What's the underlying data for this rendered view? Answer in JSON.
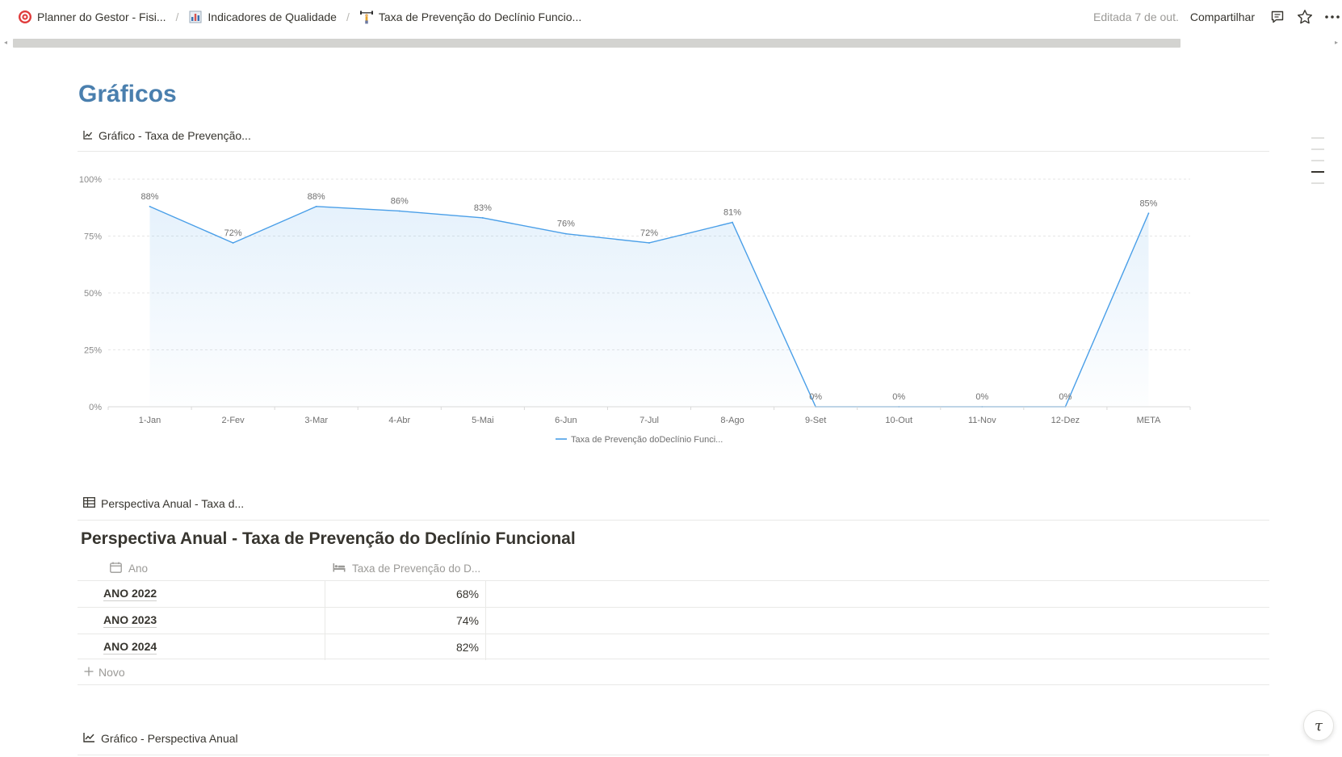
{
  "breadcrumbs": [
    {
      "label": "Planner do Gestor - Fisi...",
      "icon": "target-icon"
    },
    {
      "label": "Indicadores de Qualidade",
      "icon": "bar-chart-icon"
    },
    {
      "label": "Taxa de Prevenção do Declínio Funcio...",
      "icon": "weightlifter-icon"
    }
  ],
  "topbar": {
    "edited": "Editada 7 de out.",
    "share": "Compartilhar"
  },
  "page": {
    "heading": "Gráficos",
    "view1_label": "Gráfico - Taxa de Prevenção...",
    "view2_label": "Perspectiva Anual - Taxa d...",
    "view3_label": "Gráfico - Perspectiva Anual"
  },
  "table": {
    "title": "Perspectiva Anual - Taxa de Prevenção do Declínio Funcional",
    "col1": "Ano",
    "col2": "Taxa de Prevenção do D...",
    "rows": [
      {
        "ano": "ANO 2022",
        "taxa": "68%"
      },
      {
        "ano": "ANO 2023",
        "taxa": "74%"
      },
      {
        "ano": "ANO 2024",
        "taxa": "82%"
      }
    ],
    "new_label": "Novo"
  },
  "colors": {
    "line": "#4a9fe8",
    "heading": "#4a7fae"
  },
  "chart_data": {
    "type": "area",
    "categories": [
      "1-Jan",
      "2-Fev",
      "3-Mar",
      "4-Abr",
      "5-Mai",
      "6-Jun",
      "7-Jul",
      "8-Ago",
      "9-Set",
      "10-Out",
      "11-Nov",
      "12-Dez",
      "META"
    ],
    "series": [
      {
        "name": "Taxa de Prevenção doDeclínio Funci...",
        "values": [
          88,
          72,
          88,
          86,
          83,
          76,
          72,
          81,
          0,
          0,
          0,
          0,
          85
        ]
      }
    ],
    "data_labels": [
      "88%",
      "72%",
      "88%",
      "86%",
      "83%",
      "76%",
      "72%",
      "81%",
      "0%",
      "0%",
      "0%",
      "0%",
      "85%"
    ],
    "y_ticks": [
      "0%",
      "25%",
      "50%",
      "75%",
      "100%"
    ],
    "ylim": [
      0,
      100
    ],
    "grid": true,
    "legend": "bottom-center"
  }
}
